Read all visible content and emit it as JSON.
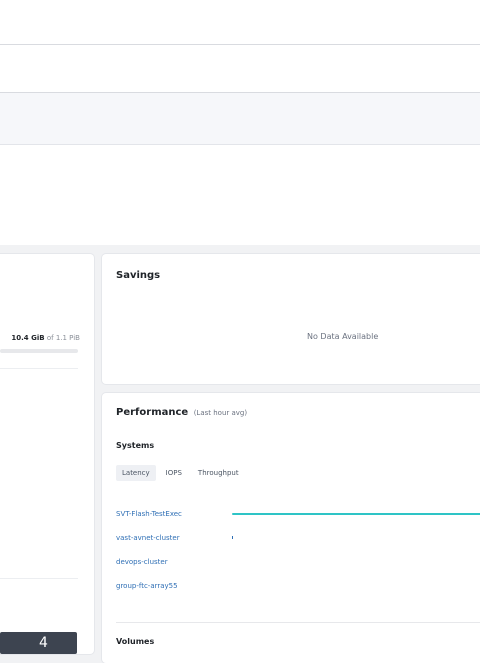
{
  "storage_card": {
    "used": "10.4 GiB",
    "of_text": "of 1.1 PiB",
    "button_label": "4"
  },
  "savings_card": {
    "title": "Savings",
    "empty_message": "No Data Available"
  },
  "performance_card": {
    "title": "Performance",
    "subtitle": "(Last hour avg)",
    "systems_heading": "Systems",
    "tabs": [
      {
        "label": "Latency",
        "active": true
      },
      {
        "label": "IOPS",
        "active": false
      },
      {
        "label": "Throughput",
        "active": false
      }
    ],
    "systems": [
      {
        "name": "SVT-Flash-TestExec"
      },
      {
        "name": "vast-avnet-cluster"
      },
      {
        "name": "devops-cluster"
      },
      {
        "name": "group-ftc-array55"
      }
    ],
    "volumes_heading": "Volumes"
  },
  "colors": {
    "latency_bar": "#2ec4c6",
    "link": "#2f6fb5"
  }
}
